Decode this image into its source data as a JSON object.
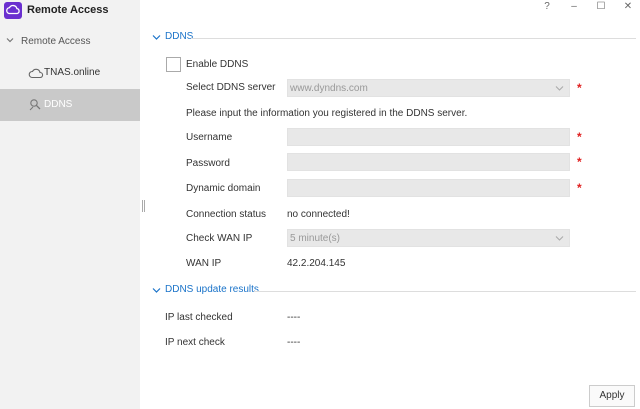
{
  "app": {
    "title": "Remote Access",
    "brand_color": "#6a2fcf"
  },
  "window_controls": {
    "help": "?",
    "minimize": "–",
    "maximize": "☐",
    "close": "✕"
  },
  "sidebar": {
    "group_label": "Remote Access",
    "items": [
      {
        "label": "TNAS.online",
        "icon": "cloud-icon",
        "selected": false
      },
      {
        "label": "DDNS",
        "icon": "ddns-icon",
        "selected": true
      }
    ]
  },
  "ddns_section": {
    "title": "DDNS",
    "enable_label": "Enable DDNS",
    "enable_checked": false,
    "server_label": "Select DDNS server",
    "server_value": "www.dyndns.com",
    "info_text": "Please input the information you registered in the DDNS server.",
    "username_label": "Username",
    "username_value": "",
    "password_label": "Password",
    "password_value": "",
    "domain_label": "Dynamic domain",
    "domain_value": "",
    "required_mark": "*",
    "status_label": "Connection status",
    "status_value": "no connected!",
    "wan_check_label": "Check WAN IP",
    "wan_check_value": "5 minute(s)",
    "wan_ip_label": "WAN IP",
    "wan_ip_value": "42.2.204.145"
  },
  "results_section": {
    "title": "DDNS update results",
    "last_checked_label": "IP last checked",
    "last_checked_value": "----",
    "next_check_label": "IP next check",
    "next_check_value": "----"
  },
  "apply_label": "Apply",
  "colors": {
    "accent": "#1a73c9",
    "required": "#e02020",
    "selected_nav": "#c9c9c9"
  }
}
